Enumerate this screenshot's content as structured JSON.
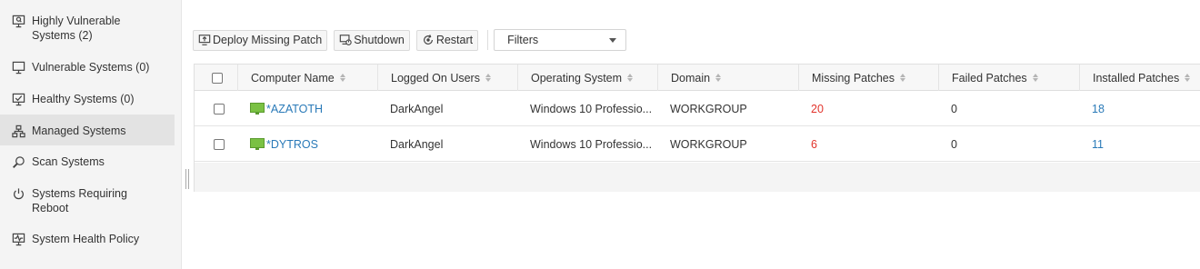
{
  "sidebar": {
    "items": [
      {
        "icon": "vulnerable-monitor-icon",
        "line1": "Highly Vulnerable",
        "line2": "Systems (2)"
      },
      {
        "icon": "monitor-icon",
        "line1": "Vulnerable Systems (0)",
        "line2": ""
      },
      {
        "icon": "healthy-monitor-icon",
        "line1": "Healthy Systems (0)",
        "line2": ""
      },
      {
        "icon": "network-icon",
        "line1": "Managed Systems",
        "line2": ""
      },
      {
        "icon": "search-icon",
        "line1": "Scan Systems",
        "line2": ""
      },
      {
        "icon": "power-icon",
        "line1": "Systems Requiring",
        "line2": "Reboot"
      },
      {
        "icon": "health-policy-icon",
        "line1": "System Health Policy",
        "line2": ""
      }
    ],
    "active_index": 3
  },
  "toolbar": {
    "deploy_label": "Deploy Missing Patch",
    "shutdown_label": "Shutdown",
    "restart_label": "Restart",
    "filter_label": "Filters"
  },
  "table": {
    "columns": [
      "Computer Name",
      "Logged On Users",
      "Operating System",
      "Domain",
      "Missing Patches",
      "Failed Patches",
      "Installed Patches"
    ],
    "rows": [
      {
        "computer": "AZATOTH",
        "user": "DarkAngel",
        "os": "Windows 10 Professio...",
        "domain": "WORKGROUP",
        "missing": "20",
        "failed": "0",
        "installed": "18"
      },
      {
        "computer": "DYTROS",
        "user": "DarkAngel",
        "os": "Windows 10 Professio...",
        "domain": "WORKGROUP",
        "missing": "6",
        "failed": "0",
        "installed": "11"
      }
    ],
    "agent_mark": "*"
  },
  "colors": {
    "missing": "#e2342c",
    "link": "#2a7ab8",
    "monitor": "#7ac143"
  }
}
